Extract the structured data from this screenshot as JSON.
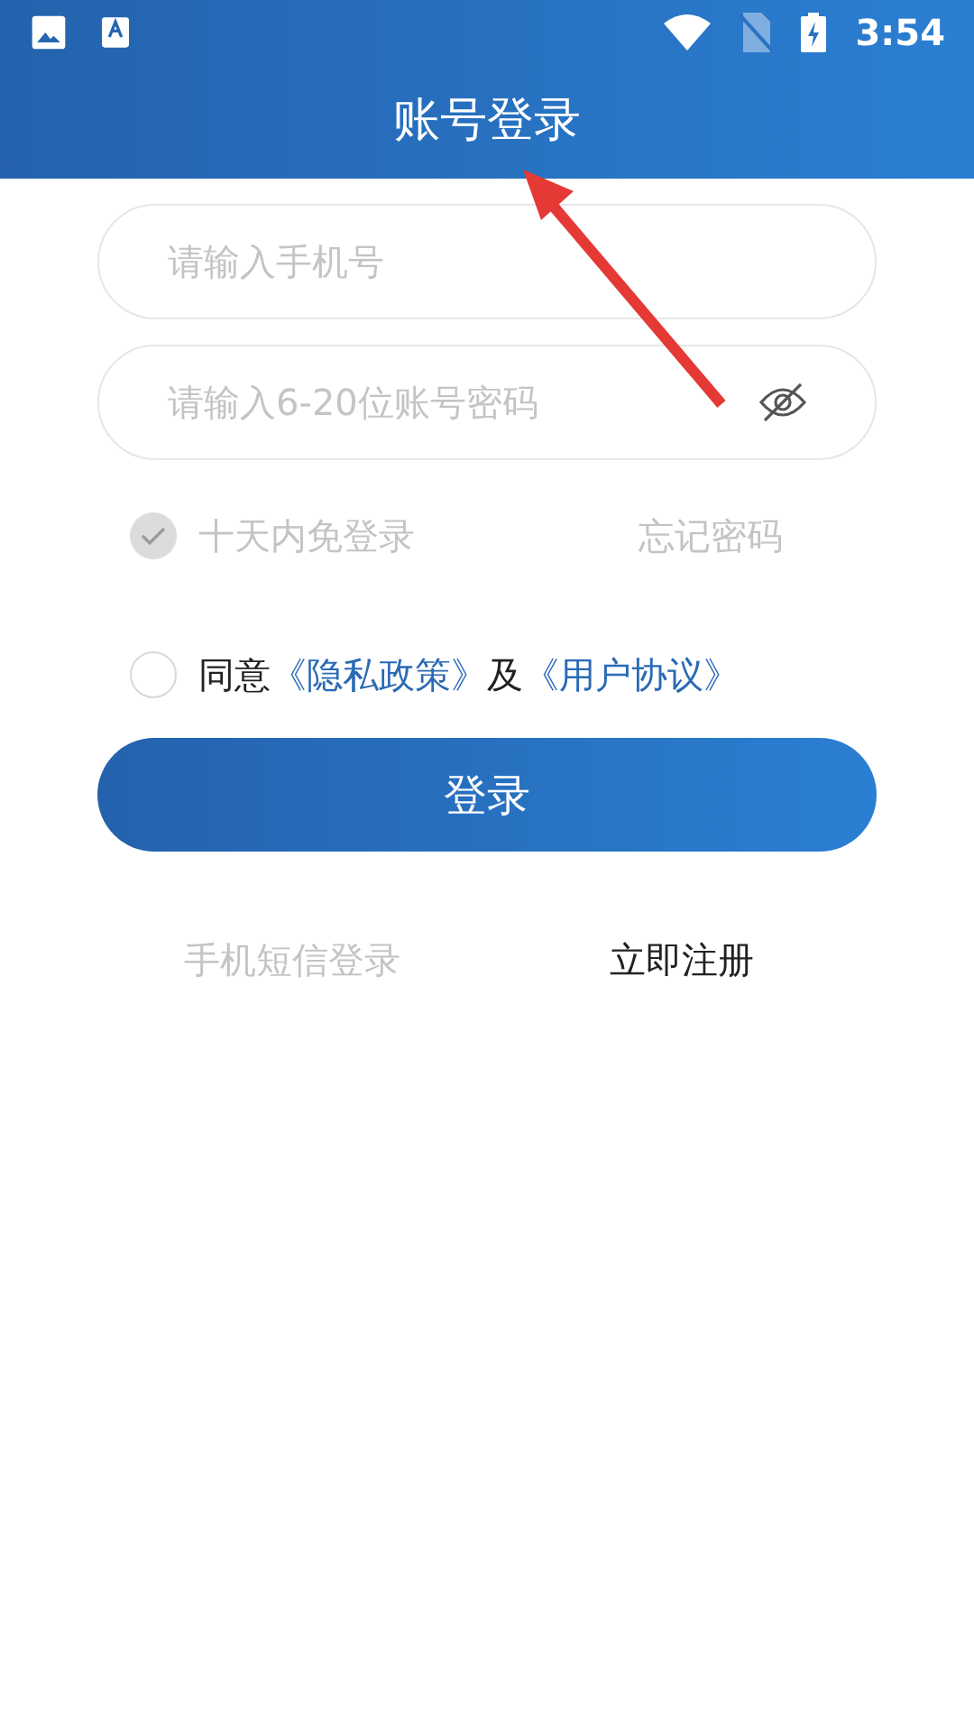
{
  "status_bar": {
    "time": "3:54"
  },
  "title": "账号登录",
  "fields": [
    {
      "kind": "phone",
      "placeholder": "请输入手机号"
    },
    {
      "kind": "password",
      "placeholder": "请输入6-20位账号密码"
    }
  ],
  "remember": {
    "label": "十天内免登录",
    "checked": true
  },
  "forgot": "忘记密码",
  "agreement": {
    "checked": false,
    "parts": [
      {
        "kind": "text",
        "text": "同意"
      },
      {
        "kind": "link",
        "text": "《隐私政策》"
      },
      {
        "kind": "text",
        "text": "及"
      },
      {
        "kind": "link",
        "text": "《用户协议》"
      }
    ]
  },
  "login_button": "登录",
  "bottom_links": [
    {
      "text": "手机短信登录",
      "disabled": true
    },
    {
      "text": "立即注册",
      "disabled": false
    }
  ]
}
